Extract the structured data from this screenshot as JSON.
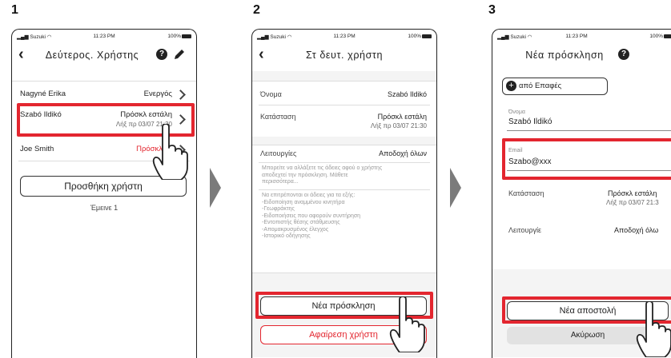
{
  "steps": [
    "1",
    "2",
    "3"
  ],
  "status": {
    "carrier": "Suzuki",
    "time": "11:23 PM",
    "battery": "100%"
  },
  "screen1": {
    "title": "Δεύτερος. Χρήστης",
    "users": [
      {
        "name": "Nagyné Erika",
        "status": "Ενεργός",
        "sub": ""
      },
      {
        "name": "Szabó Ildikó",
        "status": "Πρόσκλ εστάλη",
        "sub": "Λήξ πρ 03/07 21:30"
      },
      {
        "name": "Joe Smith",
        "status": "Πρόσκλ",
        "sub": ""
      }
    ],
    "add_button": "Προσθήκη χρήστη",
    "remaining": "Έμεινε 1",
    "colors": {
      "red": "#e3262f"
    }
  },
  "screen2": {
    "title": "Στ δευτ. χρήστη",
    "name_label": "Όνομα",
    "name_value": "Szabó Ildikó",
    "status_label": "Κατάσταση",
    "status_value": "Πρόσκλ εστάλη",
    "status_sub": "Λήξ πρ 03/07 21:30",
    "functions_label": "Λειτουργίες",
    "functions_value": "Αποδοχή όλων",
    "info_lines": [
      "Μπορείτε να αλλάξετε τις άδειες αφού ο χρήστης",
      "αποδεχτεί την πρόσκληση. Μάθετε",
      "περισσότερα..."
    ],
    "allowed_title": "Να επιτρέπονται οι άδειες για τα εξής:",
    "allowed_items": [
      "-Ειδοποίηση αναμμένου κινητήρα",
      "-Γεωφράκτης",
      "-Ειδοποιήσεις που αφορούν συντήρηση",
      "-Εντοπιστής θέσης στάθμευσης",
      "-Απομακρυσμένος έλεγχος",
      "-Ιστορικό οδήγησης"
    ],
    "new_invite_button": "Νέα πρόσκληση",
    "remove_button": "Αφαίρεση χρήστη"
  },
  "screen3": {
    "title": "Νέα πρόσκληση",
    "contacts_button": "από Επαφές",
    "name_label": "Όνομα",
    "name_value": "Szabó Ildikó",
    "email_label": "Email",
    "email_value": "Szabo@xxx",
    "status_label": "Κατάσταση",
    "status_value": "Πρόσκλ εστάλη",
    "status_sub": "Λήξ πρ 03/07 21:3",
    "functions_label": "Λειτουργίε",
    "functions_value": "Αποδοχή όλω",
    "send_button": "Νέα αποστολή",
    "cancel_button": "Ακύρωση"
  }
}
